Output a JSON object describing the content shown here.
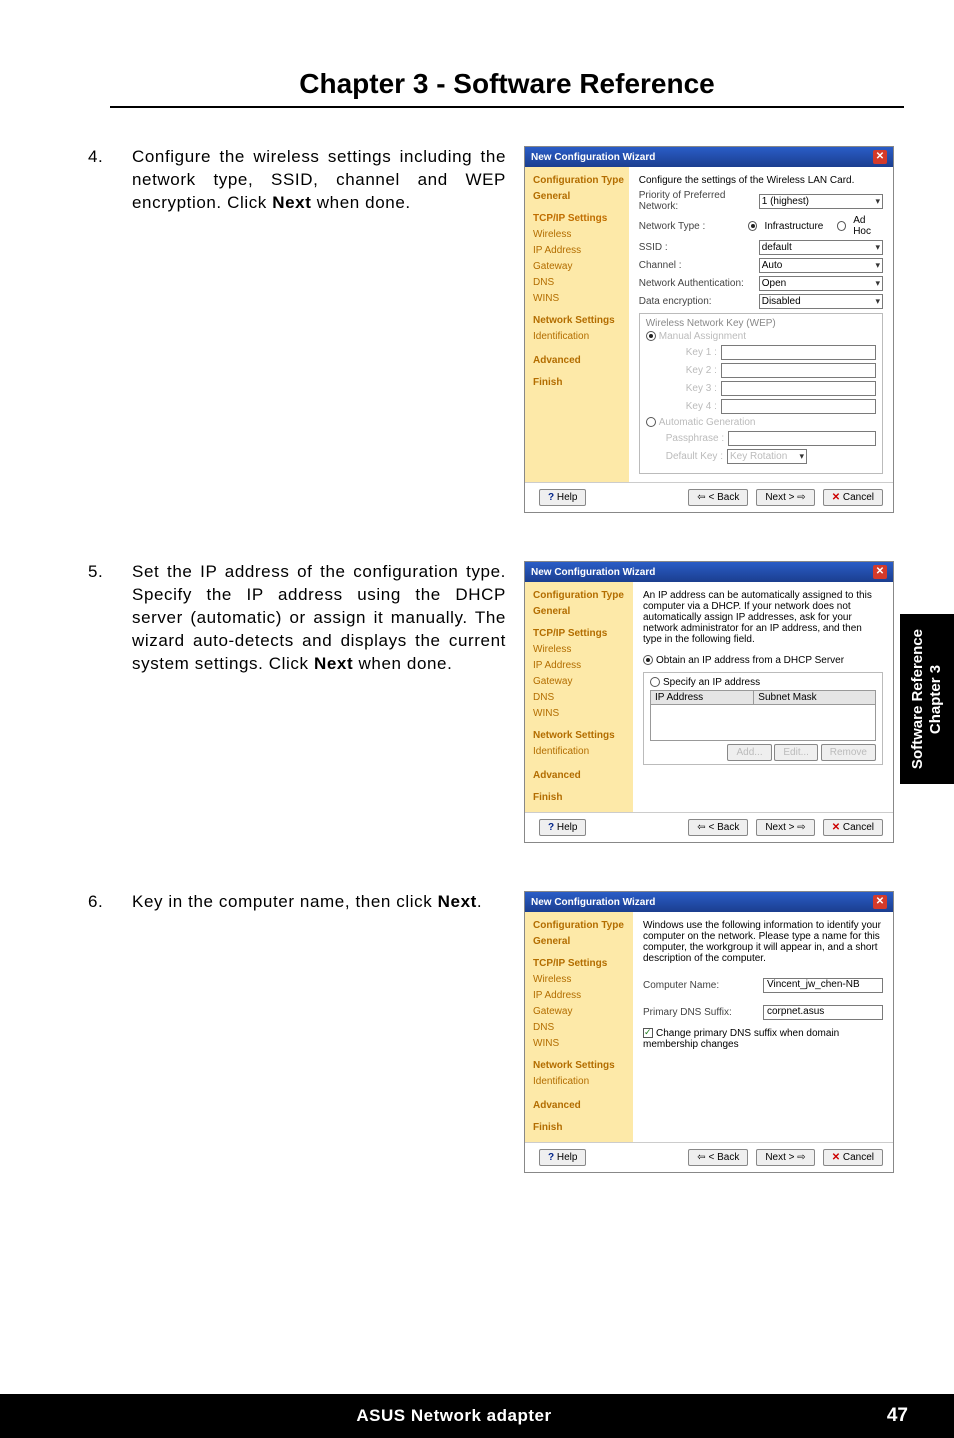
{
  "chapter_heading": "Chapter 3 - Software Reference",
  "step4": {
    "num": "4.",
    "text_a": "Configure the wireless settings including the network type, SSID, channel and WEP encryption. Click ",
    "next": "Next",
    "text_b": " when done."
  },
  "step5": {
    "num": "5.",
    "text_a": "Set the IP address of the configuration type. Specify the IP address using the DHCP server (automatic) or assign it manually. The wizard auto-detects and displays the current system settings. Click ",
    "next": "Next",
    "text_b": " when done."
  },
  "step6": {
    "num": "6.",
    "text_a": "Key in the computer name, then click ",
    "next": "Next",
    "text_b": "."
  },
  "nav": {
    "a": "Configuration Type",
    "b": "General",
    "c": "TCP/IP Settings",
    "c1": "Wireless",
    "c2": "IP Address",
    "c3": "Gateway",
    "c4": "DNS",
    "c5": "WINS",
    "d": "Network Settings",
    "d1": "Identification",
    "e": "Advanced",
    "f": "Finish"
  },
  "wiz": {
    "title": "New Configuration Wizard",
    "btn_help": "Help",
    "btn_back": "< Back",
    "btn_next": "Next >",
    "btn_cancel": "Cancel"
  },
  "w1": {
    "intro": "Configure the settings of the Wireless LAN Card.",
    "l_priority": "Priority of Preferred Network:",
    "v_priority": "1 (highest)",
    "l_ntype": "Network Type :",
    "r_infra": "Infrastructure",
    "r_adhoc": "Ad Hoc",
    "l_ssid": "SSID :",
    "v_ssid": "default",
    "l_channel": "Channel :",
    "v_channel": "Auto",
    "l_auth": "Network Authentication:",
    "v_auth": "Open",
    "l_enc": "Data encryption:",
    "v_enc": "Disabled",
    "grp": "Wireless Network Key (WEP)",
    "r_manual": "Manual Assignment",
    "k1": "Key 1 :",
    "k2": "Key 2 :",
    "k3": "Key 3 :",
    "k4": "Key 4 :",
    "r_auto": "Automatic Generation",
    "pass": "Passphrase :",
    "defk": "Default Key :",
    "rot": "Key Rotation"
  },
  "w2": {
    "intro": "An IP address can be automatically assigned to this computer via a DHCP. If your network does not automatically assign IP addresses, ask for your network administrator for an IP address, and then type in the following field.",
    "r_obtain": "Obtain an IP address from a DHCP Server",
    "r_specify": "Specify an IP address",
    "th1": "IP Address",
    "th2": "Subnet Mask",
    "b_add": "Add...",
    "b_edit": "Edit...",
    "b_rem": "Remove"
  },
  "w3": {
    "intro": "Windows use the following information to identify your computer on the network. Please type a name for this computer, the workgroup it will appear in, and a short description of the computer.",
    "l_cname": "Computer Name:",
    "v_cname": "Vincent_jw_chen-NB",
    "l_dns": "Primary DNS Suffix:",
    "v_dns": "corpnet.asus",
    "chk": "Change primary DNS suffix when domain membership changes"
  },
  "side": {
    "a": "Chapter 3",
    "b": "Software Reference"
  },
  "footer": {
    "title": "ASUS Network adapter",
    "page": "47"
  }
}
